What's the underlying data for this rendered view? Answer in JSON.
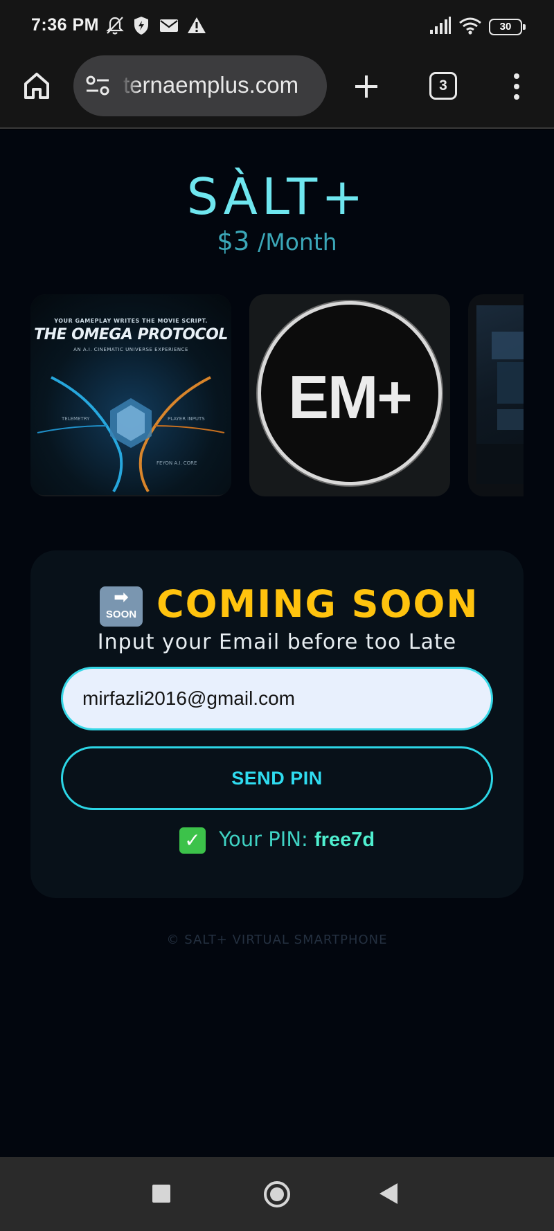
{
  "status_bar": {
    "time": "7:36 PM",
    "battery": "30",
    "icons": [
      "bell-off-icon",
      "shield-icon",
      "mail-icon",
      "warning-icon",
      "signal-icon",
      "wifi-icon",
      "battery-icon"
    ]
  },
  "browser": {
    "url": "ternaemplus.com",
    "tab_count": "3",
    "icons": [
      "home-icon",
      "site-settings-icon",
      "new-tab-icon",
      "tabs-icon",
      "more-icon"
    ]
  },
  "page": {
    "brand": "SÀLT+",
    "price": "$3",
    "price_period": "/Month",
    "carousel": {
      "card1": {
        "tagline": "YOUR GAMEPLAY WRITES THE MOVIE SCRIPT.",
        "title": "THE OMEGA PROTOCOL",
        "subtitle": "AN A.I. CINEMATIC UNIVERSE EXPERIENCE",
        "label_left": "TELEMETRY",
        "label_right": "PLAYER INPUTS",
        "label_bottom": "FEYON A.I. CORE"
      },
      "card2": {
        "logo_text": "EM+"
      }
    },
    "panel": {
      "icon_word": "SOON",
      "icon_arrow": "➡",
      "heading": "COMING SOON",
      "subheading": "Input your Email before too Late",
      "email_value": "mirfazli2016@gmail.com",
      "button_label": "SEND PIN",
      "check_glyph": "✓",
      "pin_label": "Your PIN:",
      "pin_value": "free7d"
    },
    "footer": "© SALT+ VIRTUAL SMARTPHONE"
  },
  "colors": {
    "accent_cyan": "#35d7e6",
    "heading_yellow": "#ffc30e",
    "page_bg": "#02060e",
    "panel_bg": "#081119"
  },
  "nav": {
    "icons": [
      "recents-icon",
      "home-circle-icon",
      "back-icon"
    ]
  }
}
